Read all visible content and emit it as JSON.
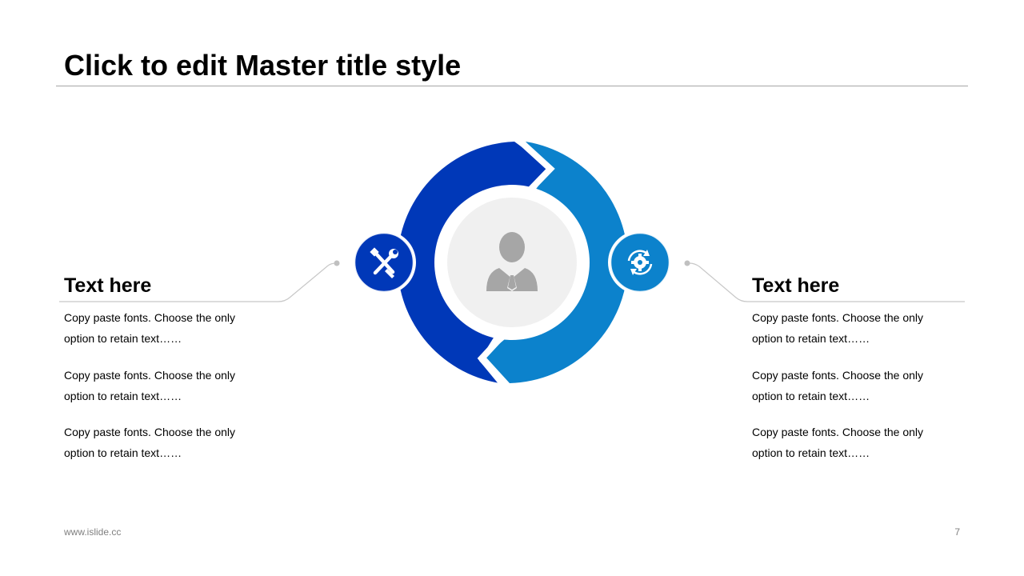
{
  "slide": {
    "title": "Click to edit Master title style",
    "footer_url": "www.islide.cc",
    "page_number": "7"
  },
  "left_block": {
    "heading": "Text here",
    "paragraphs": [
      "Copy paste fonts. Choose the only option to retain text……",
      "Copy paste fonts. Choose the only option to retain text……",
      "Copy paste fonts. Choose the only option to retain text……"
    ]
  },
  "right_block": {
    "heading": "Text here",
    "paragraphs": [
      "Copy paste fonts. Choose the only option to retain text……",
      "Copy paste fonts. Choose the only option to retain text……",
      "Copy paste fonts. Choose the only option to retain text……"
    ]
  },
  "diagram": {
    "left_icon": "tools-icon",
    "right_icon": "gear-refresh-icon",
    "center_icon": "person-icon",
    "colors": {
      "left_arc": "#0038b8",
      "right_arc": "#0c82cc",
      "center_fill": "#f0f0f0",
      "person": "#a6a6a6",
      "connector": "#c0c0c0",
      "rule": "#a6a6a6"
    }
  }
}
